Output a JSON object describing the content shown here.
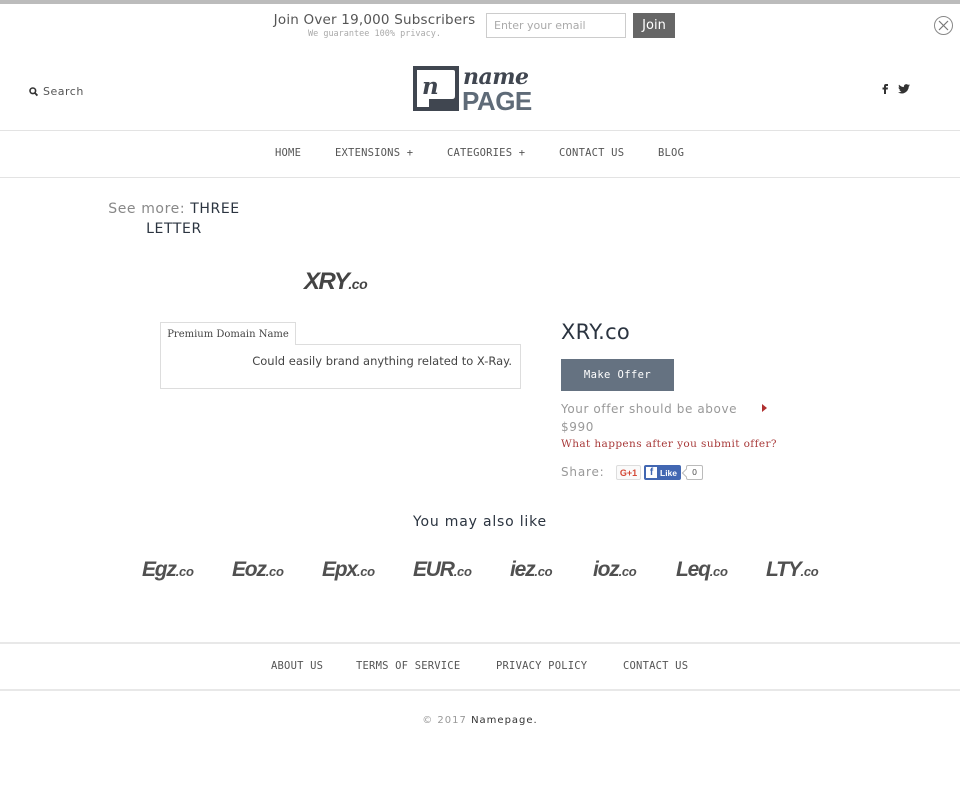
{
  "newsletter": {
    "title": "Join Over 19,000 Subscribers",
    "subtitle": "We guarantee 100% privacy.",
    "email_placeholder": "Enter your email",
    "email_value": "",
    "join_label": "Join",
    "close_icon": "close-circle-icon"
  },
  "header": {
    "search_label": "Search",
    "search_icon": "search-icon",
    "logo": {
      "top_word": "name",
      "bottom_word": "PAGE",
      "badge_letter": "n"
    },
    "social": [
      {
        "name": "facebook",
        "icon": "facebook-icon",
        "glyph": "f"
      },
      {
        "name": "twitter",
        "icon": "twitter-icon"
      }
    ]
  },
  "nav": {
    "items": [
      {
        "label": "HOME"
      },
      {
        "label": "EXTENSIONS +"
      },
      {
        "label": "CATEGORIES +"
      },
      {
        "label": "CONTACT US"
      },
      {
        "label": "BLOG"
      }
    ]
  },
  "see_more": {
    "label": "See more:",
    "link_line1": "THREE",
    "link_line2": "LETTER"
  },
  "product": {
    "logo_name": "XRY",
    "logo_tld": ".co",
    "tab_label": "Premium Domain Name",
    "description": "Could easily brand anything related to X-Ray.",
    "title": "XRY.co",
    "make_offer_label": "Make Offer",
    "offer_note": "Your offer should be above",
    "offer_min": "$990",
    "what_happens_label": "What happens after you submit offer?",
    "share_label": "Share:",
    "gplus_label": "G+1",
    "fb_like_label": "Like",
    "fb_like_count": "0",
    "accent_color": "#a83a3a",
    "button_color": "#657281"
  },
  "related": {
    "heading": "You may also like",
    "items": [
      {
        "name": "Egz",
        "tld": ".co"
      },
      {
        "name": "Eoz",
        "tld": ".co"
      },
      {
        "name": "Epx",
        "tld": ".co"
      },
      {
        "name": "EUR",
        "tld": ".co"
      },
      {
        "name": "iez",
        "tld": ".co"
      },
      {
        "name": "ioz",
        "tld": ".co"
      },
      {
        "name": "Leq",
        "tld": ".co"
      },
      {
        "name": "LTY",
        "tld": ".co"
      }
    ]
  },
  "footer": {
    "links": [
      {
        "label": "ABOUT US"
      },
      {
        "label": "TERMS OF SERVICE"
      },
      {
        "label": "PRIVACY POLICY"
      },
      {
        "label": "CONTACT US"
      }
    ],
    "copyright_prefix": "© 2017",
    "brand": "Namepage."
  }
}
